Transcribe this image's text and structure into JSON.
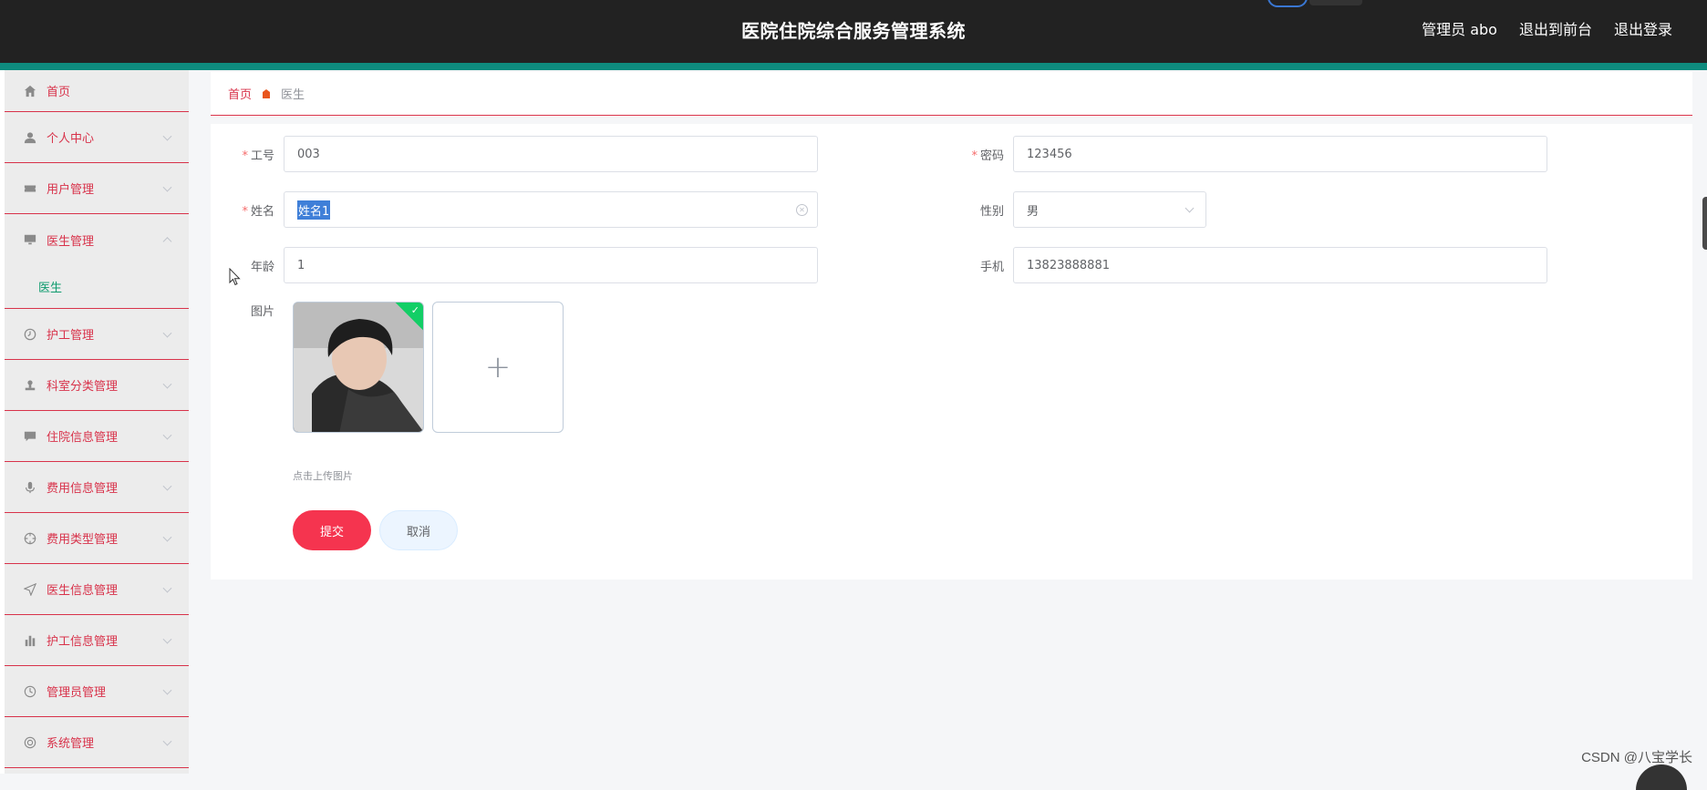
{
  "header": {
    "title": "医院住院综合服务管理系统",
    "user": "管理员 abo",
    "to_front": "退出到前台",
    "logout": "退出登录"
  },
  "sidebar": {
    "items": [
      {
        "label": "首页",
        "icon": "home-icon"
      },
      {
        "label": "个人中心",
        "icon": "user-icon"
      },
      {
        "label": "用户管理",
        "icon": "ticket-icon"
      },
      {
        "label": "医生管理",
        "icon": "monitor-icon",
        "expanded": true,
        "children": [
          "医生"
        ]
      },
      {
        "label": "护工管理",
        "icon": "clock-icon"
      },
      {
        "label": "科室分类管理",
        "icon": "stamp-icon"
      },
      {
        "label": "住院信息管理",
        "icon": "chat-icon"
      },
      {
        "label": "费用信息管理",
        "icon": "microphone-icon"
      },
      {
        "label": "费用类型管理",
        "icon": "target-icon"
      },
      {
        "label": "医生信息管理",
        "icon": "location-arrow-icon"
      },
      {
        "label": "护工信息管理",
        "icon": "bar-chart-icon"
      },
      {
        "label": "管理员管理",
        "icon": "time-icon"
      },
      {
        "label": "系统管理",
        "icon": "setting-icon"
      }
    ]
  },
  "breadcrumb": {
    "home": "首页",
    "current": "医生"
  },
  "form": {
    "job_no": {
      "label": "工号",
      "value": "003",
      "required": true
    },
    "password": {
      "label": "密码",
      "value": "123456",
      "required": true
    },
    "name": {
      "label": "姓名",
      "value": "姓名1",
      "required": true
    },
    "gender": {
      "label": "性别",
      "value": "男"
    },
    "age": {
      "label": "年龄",
      "value": "1"
    },
    "phone": {
      "label": "手机",
      "value": "13823888881"
    },
    "picture": {
      "label": "图片",
      "tip": "点击上传图片"
    },
    "submit": "提交",
    "cancel": "取消"
  },
  "watermark": "CSDN @八宝学长",
  "colors": {
    "accent": "#d8324a",
    "header_bg": "#222222",
    "teal": "#0e8b7e",
    "submit": "#f5344f",
    "active_sub": "#0e9b6e"
  }
}
